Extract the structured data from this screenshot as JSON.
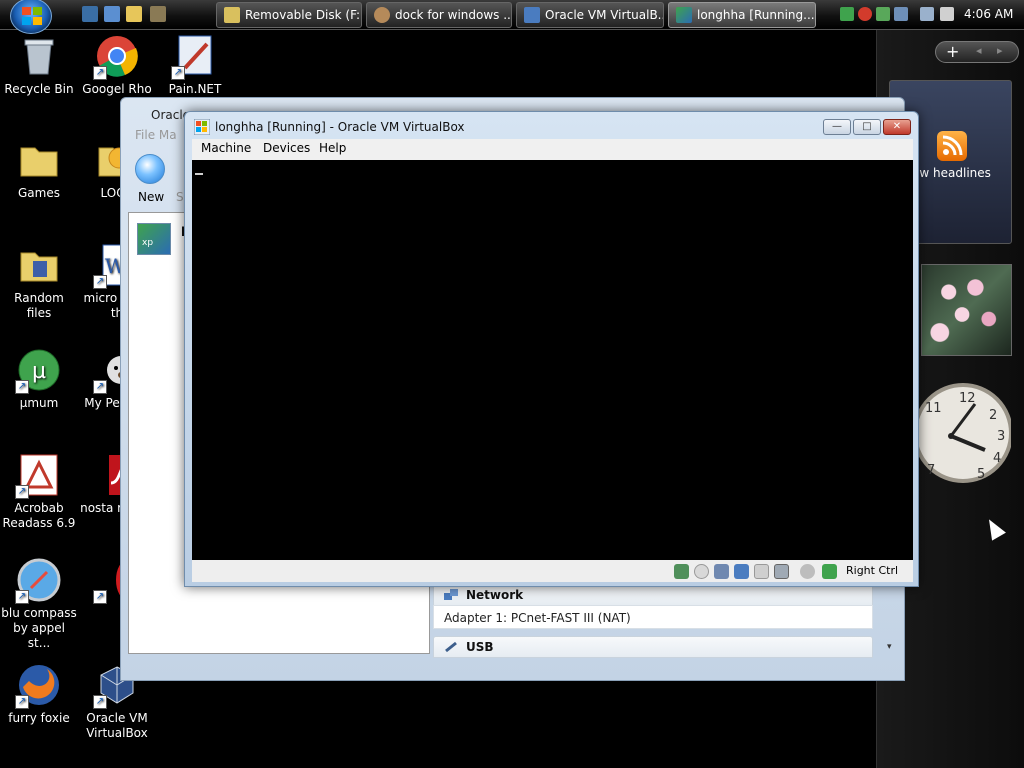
{
  "taskbar": {
    "tasks": [
      {
        "label": "Removable Disk (F:)",
        "icon": "folder-icon"
      },
      {
        "label": "dock for windows ...",
        "icon": "firefox-icon"
      },
      {
        "label": "Oracle VM VirtualB...",
        "icon": "virtualbox-icon"
      },
      {
        "label": "longhha [Running...",
        "icon": "xp-vm-icon"
      }
    ],
    "clock": "4:06 AM"
  },
  "desktop": {
    "icons": [
      {
        "label": "Recycle Bin",
        "icon": "recycle-bin-icon"
      },
      {
        "label": "Googel Rho",
        "icon": "chrome-icon"
      },
      {
        "label": "Pain.NET",
        "icon": "paint-net-icon"
      },
      {
        "label": "Games",
        "icon": "folder-icon"
      },
      {
        "label": "LOOK",
        "icon": "star-folder-icon"
      },
      {
        "label": "Random files",
        "icon": "folder-icon"
      },
      {
        "label": "micro what th",
        "icon": "word-icon"
      },
      {
        "label": "µmum",
        "icon": "utorrent-icon"
      },
      {
        "label": "My Pe shor",
        "icon": "pet-icon"
      },
      {
        "label": "Acrobab Readass 6.9",
        "icon": "acrobat-icon"
      },
      {
        "label": "nosta return",
        "icon": "flash-icon"
      },
      {
        "label": "blu compass by appel st...",
        "icon": "safari-icon"
      },
      {
        "label": "O",
        "icon": "opera-icon"
      },
      {
        "label": "furry foxie",
        "icon": "firefox-icon"
      },
      {
        "label": "Oracle VM VirtualBox",
        "icon": "virtualbox-icon"
      }
    ]
  },
  "sidebar": {
    "add_label": "+",
    "nav_arrows": "◂ ▸",
    "feed_label": "ew headlines"
  },
  "manager": {
    "title": "Oracle",
    "menu": "File   Ma",
    "new_label": "New",
    "new_label_partial": "S",
    "vm_tile_label": "xp",
    "vm_name_partial": "l",
    "sections": [
      {
        "header": "Network",
        "body": "Adapter 1: PCnet-FAST III (NAT)"
      },
      {
        "header": "USB",
        "body": ""
      }
    ],
    "scroll_arrow": "▾"
  },
  "vm": {
    "title": "longhha [Running] - Oracle VM VirtualBox",
    "menu": [
      "Machine",
      "Devices",
      "Help"
    ],
    "buttons": {
      "minimize": "—",
      "maximize": "□",
      "close": "✕"
    },
    "host_key": "Right Ctrl"
  }
}
